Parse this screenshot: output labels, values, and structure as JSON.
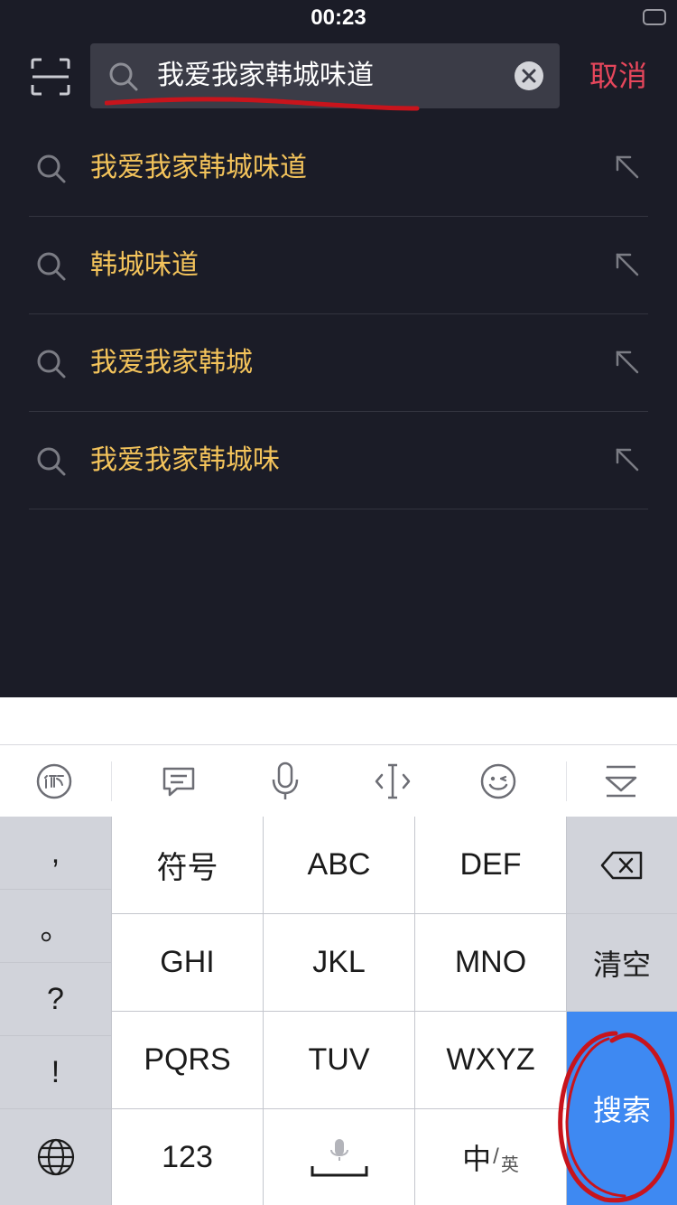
{
  "status_bar": {
    "time": "00:23"
  },
  "search": {
    "query": "我爱我家韩城味道",
    "cancel_label": "取消"
  },
  "suggestions": [
    {
      "text": "我爱我家韩城味道"
    },
    {
      "text": "韩城味道"
    },
    {
      "text": "我爱我家韩城"
    },
    {
      "text": "我爱我家韩城味"
    }
  ],
  "keyboard": {
    "punctuation": [
      ",",
      "。",
      "?",
      "!"
    ],
    "rows": [
      [
        "符号",
        "ABC",
        "DEF"
      ],
      [
        "GHI",
        "JKL",
        "MNO"
      ],
      [
        "PQRS",
        "TUV",
        "WXYZ"
      ]
    ],
    "clear_label": "清空",
    "search_label": "搜索",
    "num_label": "123",
    "lang_main": "中",
    "lang_alt": "英"
  },
  "colors": {
    "background": "#1b1c27",
    "suggestion_text": "#f3c35b",
    "cancel": "#e5465b",
    "key_accent": "#3e89f2",
    "annotation": "#c8141c"
  }
}
